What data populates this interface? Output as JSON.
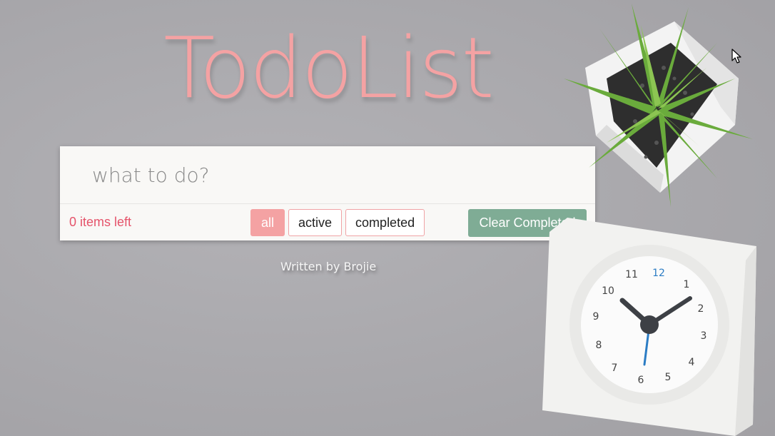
{
  "app": {
    "title": "TodoList"
  },
  "input": {
    "placeholder": "what to do?",
    "value": ""
  },
  "footer": {
    "items_left": "0 items left",
    "filters": [
      {
        "label": "all",
        "selected": true
      },
      {
        "label": "active",
        "selected": false
      },
      {
        "label": "completed",
        "selected": false
      }
    ],
    "clear_label": "Clear Completed"
  },
  "credit": "Written by Brojie",
  "decor": {
    "clock_numbers": [
      "12",
      "1",
      "2",
      "3",
      "4",
      "5",
      "6",
      "7",
      "8",
      "9",
      "10",
      "11"
    ],
    "icons": [
      "plant-icon",
      "clock-icon",
      "mouse-cursor-icon"
    ]
  },
  "colors": {
    "accent": "#f4a2a3",
    "items_left": "#e5536a",
    "clear_button": "#7fac95",
    "panel": "#f9f8f6",
    "background": "#aaa9ad"
  }
}
